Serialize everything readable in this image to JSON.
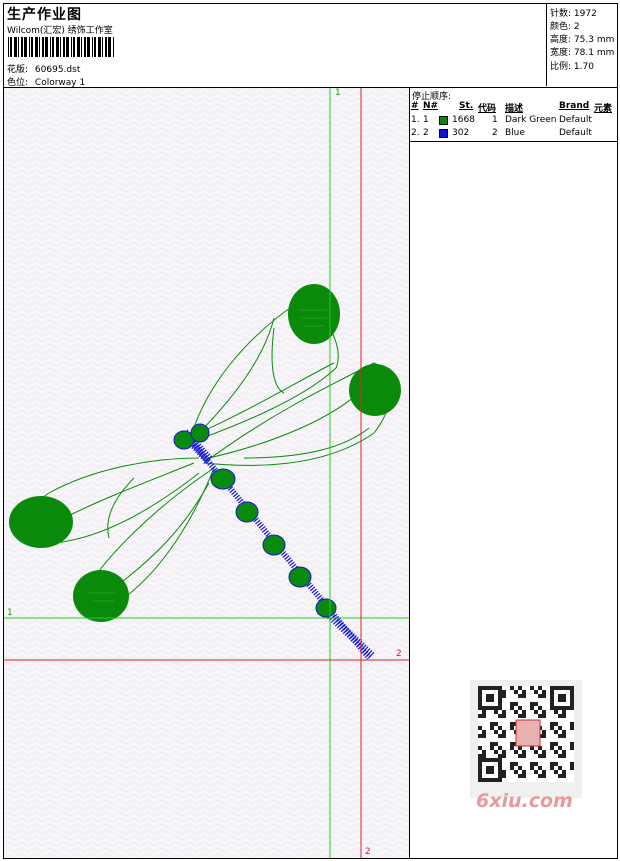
{
  "header": {
    "title": "生产作业图",
    "studio": "Wilcom(汇宏) 绣饰工作室",
    "design_label": "花版:",
    "design_value": "60695.dst",
    "colorway_label": "色位:",
    "colorway_value": "Colorway 1"
  },
  "stats": [
    {
      "label": "针数:",
      "value": "1972"
    },
    {
      "label": "颜色:",
      "value": "2"
    },
    {
      "label": "高度:",
      "value": "75.3 mm"
    },
    {
      "label": "宽度:",
      "value": "78.1 mm"
    },
    {
      "label": "比例:",
      "value": "1.70"
    }
  ],
  "stop_sequence": {
    "title": "停止顺序:",
    "columns": [
      "#",
      "N#",
      "St.",
      "代码",
      "描述",
      "Brand",
      "元素"
    ],
    "rows": [
      {
        "index": "1.",
        "needle": "1",
        "color": "#0a8a0a",
        "stitches": "1668",
        "code": "1",
        "description": "Dark Green",
        "brand": "Default"
      },
      {
        "index": "2.",
        "needle": "2",
        "color": "#1010e0",
        "stitches": "302",
        "code": "2",
        "description": "Blue",
        "brand": "Default"
      }
    ]
  },
  "canvas": {
    "markers": {
      "green_top": "1",
      "green_left": "1",
      "red_right": "2",
      "red_bottom": "2"
    },
    "colors": {
      "green": "#22cc22",
      "red": "#dd2222",
      "thread_green": "#0a8a0a",
      "thread_blue": "#1515d8"
    }
  },
  "watermark": {
    "text": "6xiu.com",
    "icon": "qr-code-icon"
  }
}
